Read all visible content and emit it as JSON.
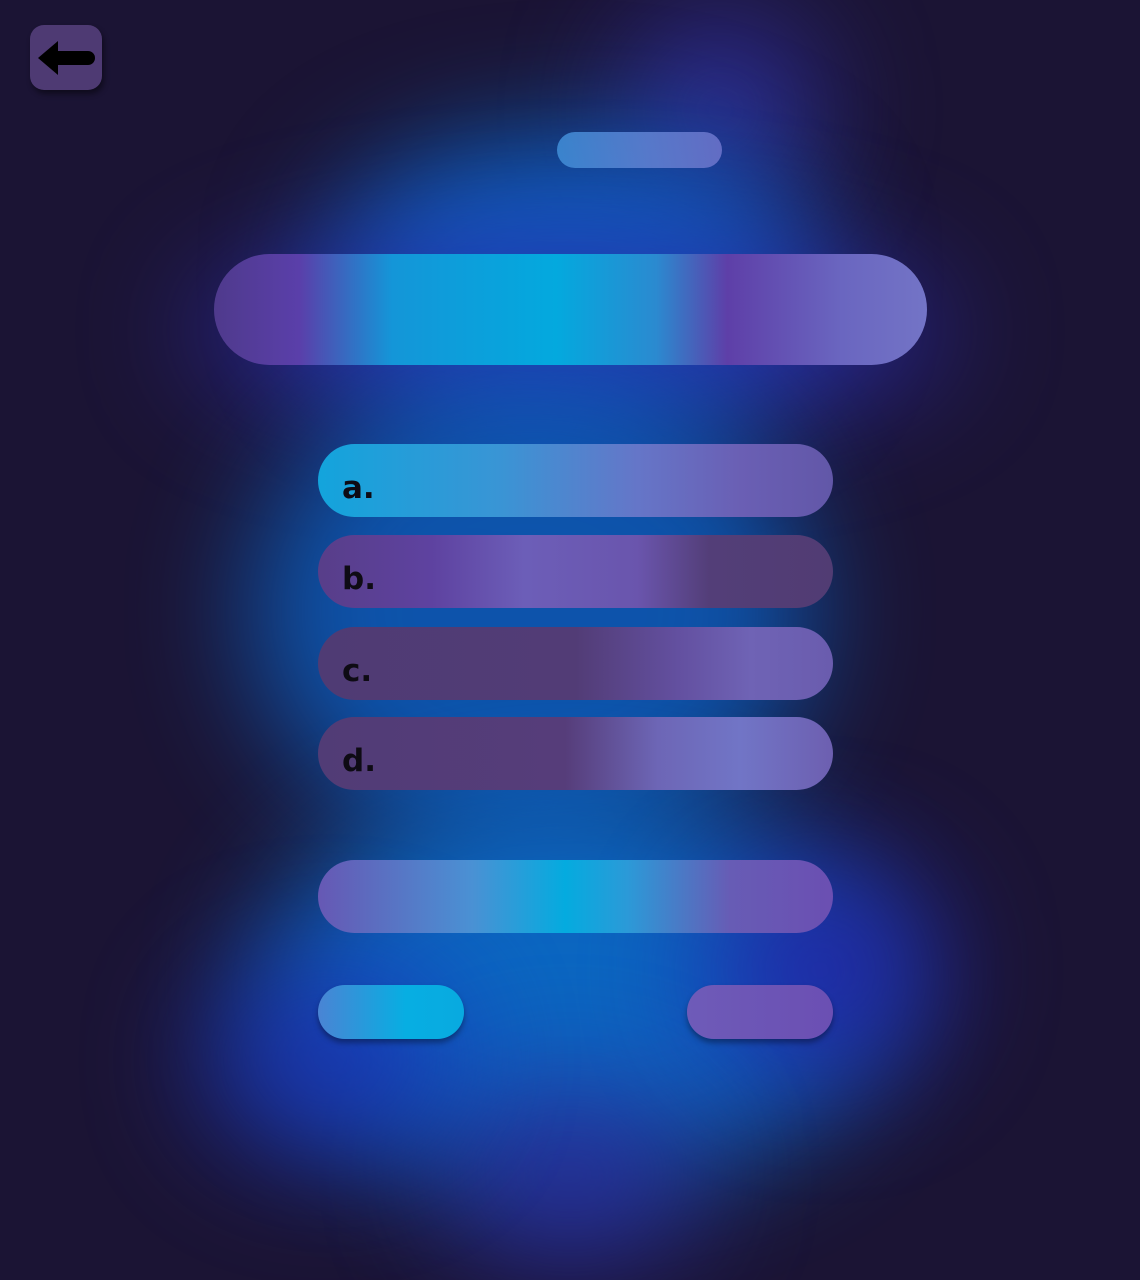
{
  "header": {
    "back_icon": "arrow-left-icon"
  },
  "question": {
    "progress_label": "",
    "text": ""
  },
  "options": [
    {
      "letter": "a.",
      "text": ""
    },
    {
      "letter": "b.",
      "text": ""
    },
    {
      "letter": "c.",
      "text": ""
    },
    {
      "letter": "d.",
      "text": ""
    }
  ],
  "answer": {
    "value": ""
  },
  "actions": {
    "left_label": "",
    "right_label": ""
  },
  "colors": {
    "background": "#1b1434",
    "accent_cyan": "#03a9de",
    "accent_purple": "#6b4fb3",
    "back_button": "#4e3a73"
  }
}
